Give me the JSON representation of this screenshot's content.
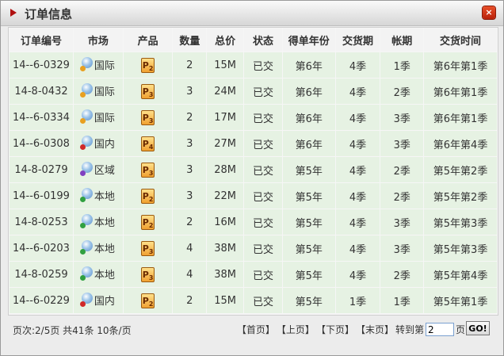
{
  "window": {
    "title": "订单信息",
    "close_label": "×"
  },
  "table": {
    "headers": [
      "订单编号",
      "市场",
      "产品",
      "数量",
      "总价",
      "状态",
      "得单年份",
      "交货期",
      "帐期",
      "交货时间"
    ],
    "rows": [
      {
        "id": "14--6-0329",
        "market": "国际",
        "product": "P",
        "product_num": "2",
        "qty": "2",
        "total": "15M",
        "status": "已交",
        "year": "第6年",
        "delivery": "4季",
        "term": "1季",
        "time": "第6年第1季"
      },
      {
        "id": "14-8-0432",
        "market": "国际",
        "product": "P",
        "product_num": "3",
        "qty": "3",
        "total": "24M",
        "status": "已交",
        "year": "第6年",
        "delivery": "4季",
        "term": "2季",
        "time": "第6年第1季"
      },
      {
        "id": "14--6-0334",
        "market": "国际",
        "product": "P",
        "product_num": "3",
        "qty": "2",
        "total": "17M",
        "status": "已交",
        "year": "第6年",
        "delivery": "4季",
        "term": "3季",
        "time": "第6年第1季"
      },
      {
        "id": "14--6-0308",
        "market": "国内",
        "product": "P",
        "product_num": "4",
        "qty": "3",
        "total": "27M",
        "status": "已交",
        "year": "第6年",
        "delivery": "4季",
        "term": "3季",
        "time": "第6年第4季"
      },
      {
        "id": "14-8-0279",
        "market": "区域",
        "product": "P",
        "product_num": "3",
        "qty": "3",
        "total": "28M",
        "status": "已交",
        "year": "第5年",
        "delivery": "4季",
        "term": "2季",
        "time": "第5年第2季"
      },
      {
        "id": "14--6-0199",
        "market": "本地",
        "product": "P",
        "product_num": "2",
        "qty": "3",
        "total": "22M",
        "status": "已交",
        "year": "第5年",
        "delivery": "4季",
        "term": "2季",
        "time": "第5年第2季"
      },
      {
        "id": "14-8-0253",
        "market": "本地",
        "product": "P",
        "product_num": "2",
        "qty": "2",
        "total": "16M",
        "status": "已交",
        "year": "第5年",
        "delivery": "4季",
        "term": "3季",
        "time": "第5年第3季"
      },
      {
        "id": "14--6-0203",
        "market": "本地",
        "product": "P",
        "product_num": "3",
        "qty": "4",
        "total": "38M",
        "status": "已交",
        "year": "第5年",
        "delivery": "4季",
        "term": "3季",
        "time": "第5年第3季"
      },
      {
        "id": "14-8-0259",
        "market": "本地",
        "product": "P",
        "product_num": "3",
        "qty": "4",
        "total": "38M",
        "status": "已交",
        "year": "第5年",
        "delivery": "4季",
        "term": "2季",
        "time": "第5年第4季"
      },
      {
        "id": "14--6-0229",
        "market": "国内",
        "product": "P",
        "product_num": "2",
        "qty": "2",
        "total": "15M",
        "status": "已交",
        "year": "第5年",
        "delivery": "1季",
        "term": "1季",
        "time": "第5年第1季"
      }
    ]
  },
  "market_icon_colors": {
    "国际": "#e8a020",
    "国内": "#d02828",
    "区域": "#8040c0",
    "本地": "#30a040"
  },
  "footer": {
    "page_info": "页次:2/5页 共41条 10条/页",
    "first": "【首页】",
    "prev": "【上页】",
    "next": "【下页】",
    "last": "【末页】",
    "goto_prefix": "转到第",
    "page_value": "2",
    "goto_suffix": "页",
    "go_label": "GO!"
  }
}
